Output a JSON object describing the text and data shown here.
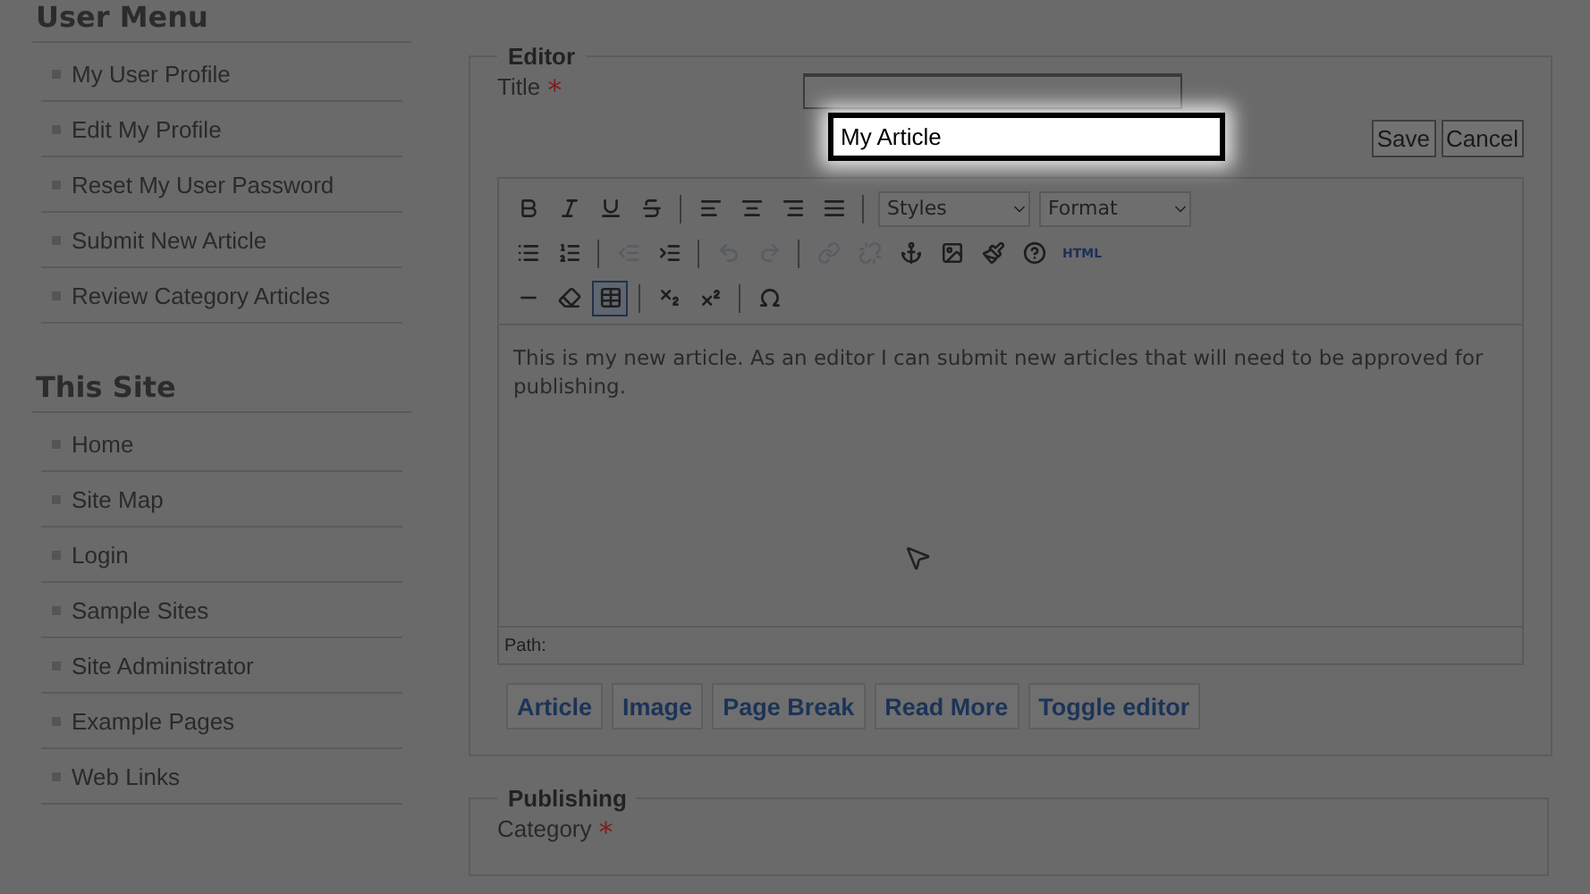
{
  "sidebar": [
    {
      "heading": "User Menu",
      "items": [
        "My User Profile",
        "Edit My Profile",
        "Reset My User Password",
        "Submit New Article",
        "Review Category Articles"
      ]
    },
    {
      "heading": "This Site",
      "items": [
        "Home",
        "Site Map",
        "Login",
        "Sample Sites",
        "Site Administrator",
        "Example Pages",
        "Web Links"
      ]
    }
  ],
  "editor": {
    "legend": "Editor",
    "title_label": "Title",
    "required_mark": "*",
    "buttons": [
      "Save",
      "Cancel"
    ],
    "toolbar": [
      [
        {
          "kind": "button",
          "disabled": false,
          "selected": false
        },
        {
          "kind": "button",
          "disabled": false,
          "selected": false
        },
        {
          "kind": "button",
          "disabled": false,
          "selected": false
        },
        {
          "kind": "button",
          "disabled": false,
          "selected": false
        },
        {
          "kind": "separator"
        },
        {
          "kind": "button",
          "disabled": false,
          "selected": false
        },
        {
          "kind": "button",
          "disabled": false,
          "selected": false
        },
        {
          "kind": "button",
          "disabled": false,
          "selected": false
        },
        {
          "kind": "button",
          "disabled": false,
          "selected": false
        },
        {
          "kind": "separator"
        },
        {
          "kind": "select",
          "label": "Styles"
        },
        {
          "kind": "select",
          "label": "Format"
        }
      ],
      [
        {
          "kind": "button",
          "disabled": false,
          "selected": false
        },
        {
          "kind": "button",
          "disabled": false,
          "selected": false
        },
        {
          "kind": "separator"
        },
        {
          "kind": "button",
          "disabled": true,
          "selected": false
        },
        {
          "kind": "button",
          "disabled": false,
          "selected": false
        },
        {
          "kind": "separator"
        },
        {
          "kind": "button",
          "disabled": true,
          "selected": false
        },
        {
          "kind": "button",
          "disabled": true,
          "selected": false
        },
        {
          "kind": "separator"
        },
        {
          "kind": "button",
          "disabled": true,
          "selected": false
        },
        {
          "kind": "button",
          "disabled": true,
          "selected": false
        },
        {
          "kind": "button",
          "disabled": false,
          "selected": false
        },
        {
          "kind": "button",
          "disabled": false,
          "selected": false
        },
        {
          "kind": "button",
          "disabled": false,
          "selected": false
        },
        {
          "kind": "button",
          "disabled": false,
          "selected": false
        },
        {
          "kind": "text",
          "label": "HTML",
          "disabled": false
        }
      ],
      [
        {
          "kind": "button",
          "disabled": false,
          "selected": false
        },
        {
          "kind": "button",
          "disabled": false,
          "selected": false
        },
        {
          "kind": "button",
          "disabled": false,
          "selected": true
        },
        {
          "kind": "separator"
        },
        {
          "kind": "button",
          "disabled": false,
          "selected": false
        },
        {
          "kind": "button",
          "disabled": false,
          "selected": false
        },
        {
          "kind": "separator"
        },
        {
          "kind": "button",
          "disabled": false,
          "selected": false
        }
      ]
    ],
    "content": "This is my new article. As an editor I can submit new articles that will need to be approved for publishing.",
    "path_label": "Path:",
    "insert_buttons": [
      "Article",
      "Image",
      "Page Break",
      "Read More",
      "Toggle editor"
    ]
  },
  "callout": {
    "value": "My Article"
  },
  "publishing": {
    "legend": "Publishing",
    "category_label": "Category",
    "required_mark": "*"
  }
}
